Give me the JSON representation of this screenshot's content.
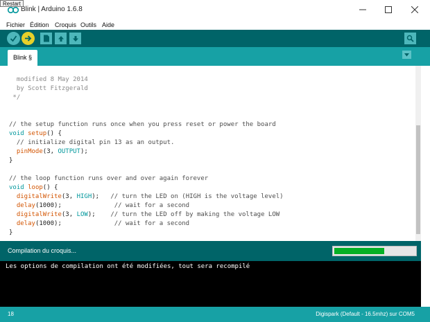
{
  "tooltip": "Restart",
  "window": {
    "title": "Blink | Arduino 1.6.8",
    "minimize_icon": "minimize-icon",
    "maximize_icon": "maximize-icon",
    "close_icon": "close-icon"
  },
  "menu": [
    "Fichier",
    "Édition",
    "Croquis",
    "Outils",
    "Aide"
  ],
  "toolbar": {
    "buttons": [
      "verify-icon",
      "upload-icon",
      "new-icon",
      "open-icon",
      "save-icon"
    ],
    "right": "serial-monitor-icon",
    "colors": {
      "bar": "#006468",
      "round": "#e7d02a",
      "square": "#4db7bb"
    }
  },
  "tabs": {
    "active": "Blink §",
    "menu_icon": "tab-menu-icon"
  },
  "code": [
    "  modified 8 May 2014",
    "  by Scott Fitzgerald",
    " */",
    "",
    "",
    "// the setup function runs once when you press reset or power the board",
    "void setup() {",
    "  // initialize digital pin 13 as an output.",
    "  pinMode(3, OUTPUT);",
    "}",
    "",
    "// the loop function runs over and over again forever",
    "void loop() {",
    "  digitalWrite(3, HIGH);   // turn the LED on (HIGH is the voltage level)",
    "  delay(1000);              // wait for a second",
    "  digitalWrite(3, LOW);    // turn the LED off by making the voltage LOW",
    "  delay(1000);              // wait for a second",
    "}"
  ],
  "status": {
    "message": "Compilation du croquis...",
    "progress": 0.62,
    "progress_color": "#06b025"
  },
  "console": {
    "lines": [
      "Les options de compilation ont été modifiées, tout sera recompilé"
    ]
  },
  "footer": {
    "line": "18",
    "board": "Digispark (Default - 16.5mhz) sur COM5"
  }
}
